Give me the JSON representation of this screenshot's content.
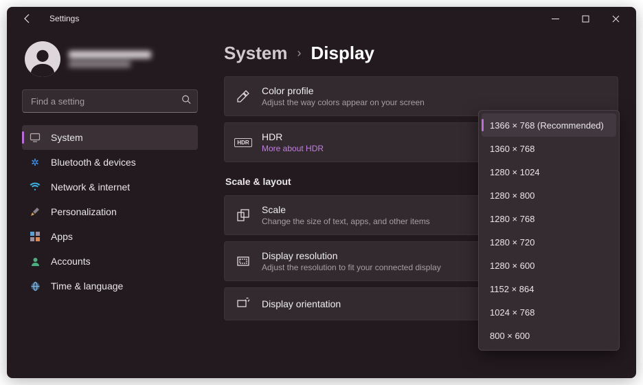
{
  "titlebar": {
    "title": "Settings"
  },
  "search": {
    "placeholder": "Find a setting"
  },
  "nav": {
    "items": [
      {
        "label": "System"
      },
      {
        "label": "Bluetooth & devices"
      },
      {
        "label": "Network & internet"
      },
      {
        "label": "Personalization"
      },
      {
        "label": "Apps"
      },
      {
        "label": "Accounts"
      },
      {
        "label": "Time & language"
      }
    ]
  },
  "breadcrumb": {
    "root": "System",
    "current": "Display"
  },
  "cards": {
    "color_profile": {
      "title": "Color profile",
      "sub": "Adjust the way colors appear on your screen"
    },
    "hdr": {
      "title": "HDR",
      "sub": "More about HDR",
      "badge": "HDR"
    },
    "section": "Scale & layout",
    "scale": {
      "title": "Scale",
      "sub": "Change the size of text, apps, and other items"
    },
    "resolution": {
      "title": "Display resolution",
      "sub": "Adjust the resolution to fit your connected display"
    },
    "orientation": {
      "title": "Display orientation"
    }
  },
  "resolution_dropdown": {
    "options": [
      "1366 × 768 (Recommended)",
      "1360 × 768",
      "1280 × 1024",
      "1280 × 800",
      "1280 × 768",
      "1280 × 720",
      "1280 × 600",
      "1152 × 864",
      "1024 × 768",
      "800 × 600"
    ]
  }
}
